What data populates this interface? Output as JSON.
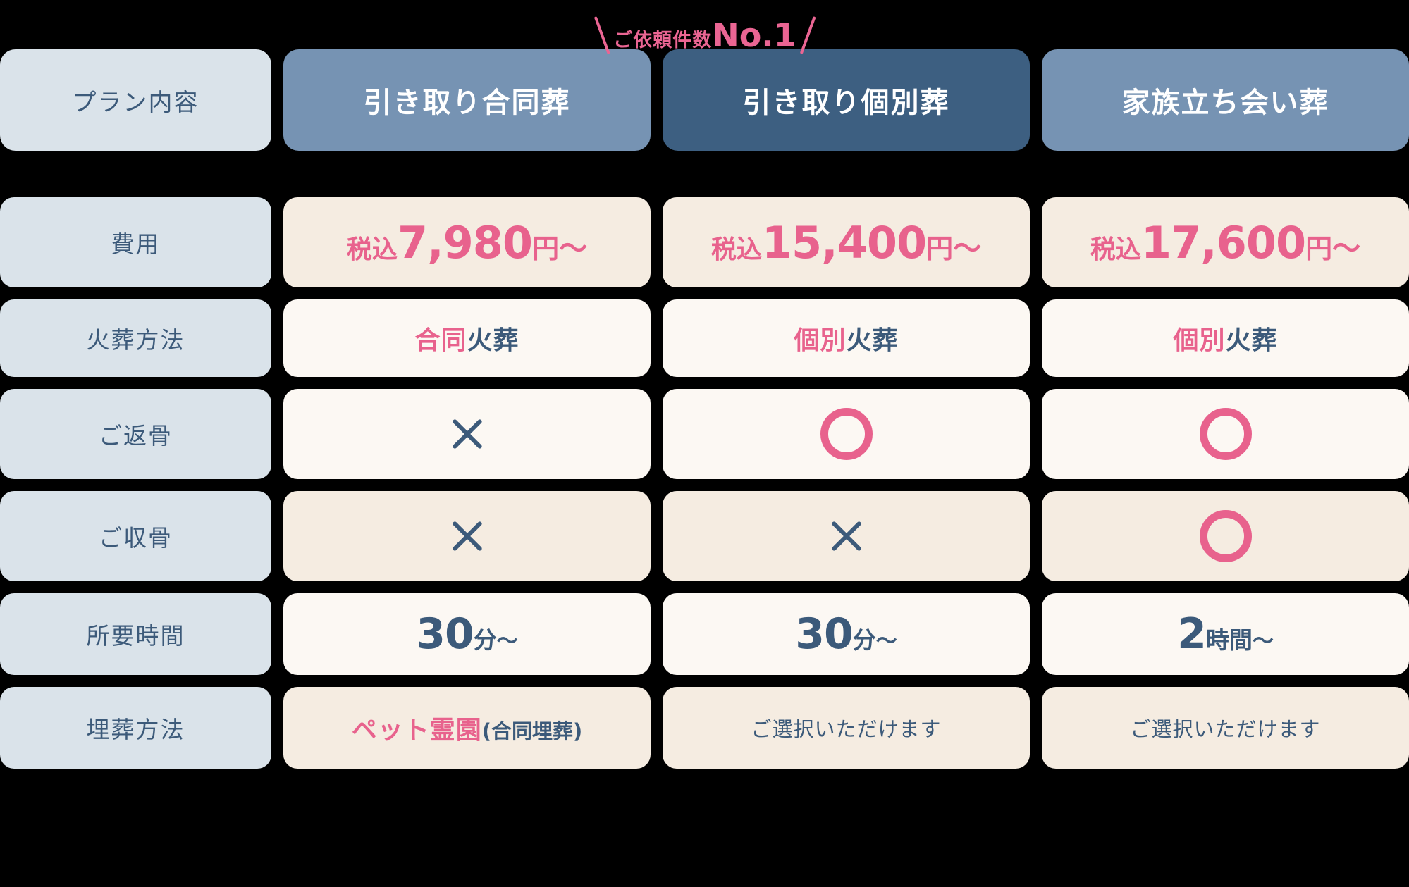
{
  "badge": {
    "small_text": "ご依頼件数",
    "big_text": "No.1",
    "color": "#ea6593"
  },
  "colors": {
    "pink": "#e8628d",
    "navy": "#3c5a7a",
    "label_bg": "#dae3ea",
    "header_bg": "#7693b3",
    "header_featured_bg": "#3d5f81",
    "cell_beige": "#f5ece1",
    "cell_cream": "#fcf8f3",
    "page_bg": "#000000"
  },
  "header": {
    "label": "プラン内容",
    "plans": [
      {
        "name": "引き取り合同葬",
        "featured": false
      },
      {
        "name": "引き取り個別葬",
        "featured": true
      },
      {
        "name": "家族立ち会い葬",
        "featured": false
      }
    ]
  },
  "rows": [
    {
      "key": "price",
      "label": "費用",
      "shade": "beige",
      "cells": [
        {
          "tax": "税込",
          "amount": "7,980",
          "yen": "円",
          "tilde": "〜"
        },
        {
          "tax": "税込",
          "amount": "15,400",
          "yen": "円",
          "tilde": "〜"
        },
        {
          "tax": "税込",
          "amount": "17,600",
          "yen": "円",
          "tilde": "〜"
        }
      ]
    },
    {
      "key": "cremation_method",
      "label": "火葬方法",
      "shade": "cream",
      "cells": [
        {
          "pink": "合同",
          "navy": "火葬"
        },
        {
          "pink": "個別",
          "navy": "火葬"
        },
        {
          "pink": "個別",
          "navy": "火葬"
        }
      ]
    },
    {
      "key": "return_of_remains",
      "label": "ご返骨",
      "shade": "cream",
      "cells": [
        {
          "mark": "cross"
        },
        {
          "mark": "circle"
        },
        {
          "mark": "circle"
        }
      ]
    },
    {
      "key": "collection_of_remains",
      "label": "ご収骨",
      "shade": "beige",
      "cells": [
        {
          "mark": "cross"
        },
        {
          "mark": "cross"
        },
        {
          "mark": "circle"
        }
      ]
    },
    {
      "key": "duration",
      "label": "所要時間",
      "shade": "cream",
      "cells": [
        {
          "num": "30",
          "unit": "分",
          "tilde": "〜"
        },
        {
          "num": "30",
          "unit": "分",
          "tilde": "〜"
        },
        {
          "num": "2",
          "unit": "時間",
          "tilde": "〜"
        }
      ]
    },
    {
      "key": "burial_method",
      "label": "埋葬方法",
      "shade": "beige",
      "cells": [
        {
          "pink": "ペット霊園",
          "navy": "(合同埋葬)"
        },
        {
          "plain": "ご選択いただけます"
        },
        {
          "plain": "ご選択いただけます"
        }
      ]
    }
  ]
}
